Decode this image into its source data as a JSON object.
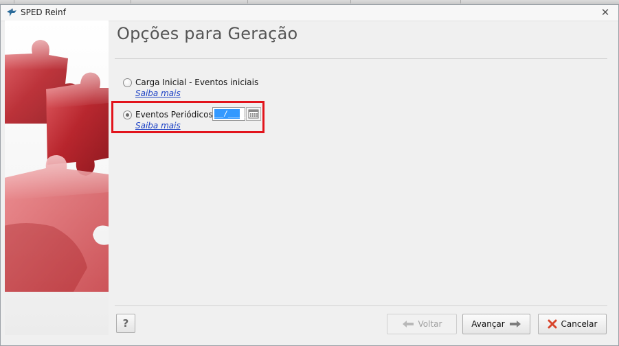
{
  "window": {
    "title": "SPED Reinf",
    "close_glyph": "✕"
  },
  "page": {
    "title": "Opções para Geração"
  },
  "options": [
    {
      "label": "Carga Inicial - Eventos iniciais",
      "link": "Saiba mais",
      "selected": false
    },
    {
      "label": "Eventos Periódicos",
      "link": "Saiba mais",
      "selected": true
    }
  ],
  "period_field": {
    "value": "__/____"
  },
  "footer": {
    "help_label": "?",
    "back_label": "Voltar",
    "next_label": "Avançar",
    "cancel_label": "Cancelar"
  },
  "icons": {
    "app": "sped-bird-icon",
    "calendar": "calendar-icon",
    "back": "arrow-left-icon",
    "next": "arrow-right-icon",
    "cancel": "red-x-icon"
  },
  "colors": {
    "highlight": "#e2141c",
    "link": "#1a3fc4",
    "selection": "#3399ff"
  }
}
